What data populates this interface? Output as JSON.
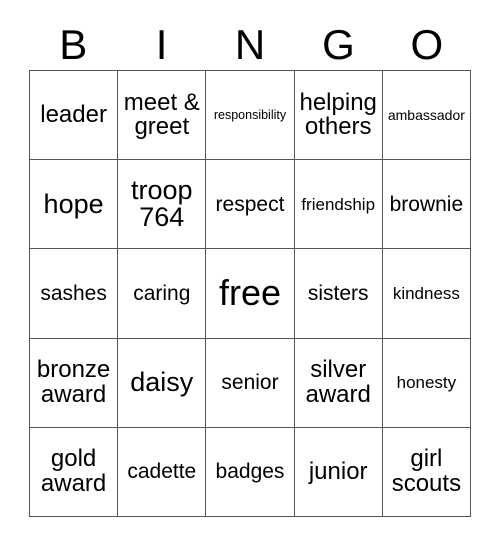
{
  "card": {
    "title": "BINGO",
    "header_letters": [
      "B",
      "I",
      "N",
      "G",
      "O"
    ],
    "columns": 5,
    "rows": 5,
    "free_space": "free",
    "free_space_position": {
      "row": 3,
      "column": 3
    },
    "colors": {
      "background": "#ffffff",
      "text": "#000000",
      "grid_line": "#555555"
    },
    "cells": [
      [
        {
          "text": "leader",
          "size": "md"
        },
        {
          "text": "meet &\ngreet",
          "size": "md"
        },
        {
          "text": "responsibility",
          "size": "tiny"
        },
        {
          "text": "helping\nothers",
          "size": "md"
        },
        {
          "text": "ambassador",
          "size": "xxs"
        }
      ],
      [
        {
          "text": "hope",
          "size": "lg"
        },
        {
          "text": "troop\n764",
          "size": "lg"
        },
        {
          "text": "respect",
          "size": "sm"
        },
        {
          "text": "friendship",
          "size": "xs"
        },
        {
          "text": "brownie",
          "size": "sm"
        }
      ],
      [
        {
          "text": "sashes",
          "size": "sm"
        },
        {
          "text": "caring",
          "size": "sm"
        },
        {
          "text": "free",
          "size": "xl"
        },
        {
          "text": "sisters",
          "size": "sm"
        },
        {
          "text": "kindness",
          "size": "xs"
        }
      ],
      [
        {
          "text": "bronze\naward",
          "size": "md"
        },
        {
          "text": "daisy",
          "size": "lg"
        },
        {
          "text": "senior",
          "size": "sm"
        },
        {
          "text": "silver\naward",
          "size": "md"
        },
        {
          "text": "honesty",
          "size": "xs"
        }
      ],
      [
        {
          "text": "gold\naward",
          "size": "md"
        },
        {
          "text": "cadette",
          "size": "sm"
        },
        {
          "text": "badges",
          "size": "sm"
        },
        {
          "text": "junior",
          "size": "md"
        },
        {
          "text": "girl\nscouts",
          "size": "md"
        }
      ]
    ]
  }
}
